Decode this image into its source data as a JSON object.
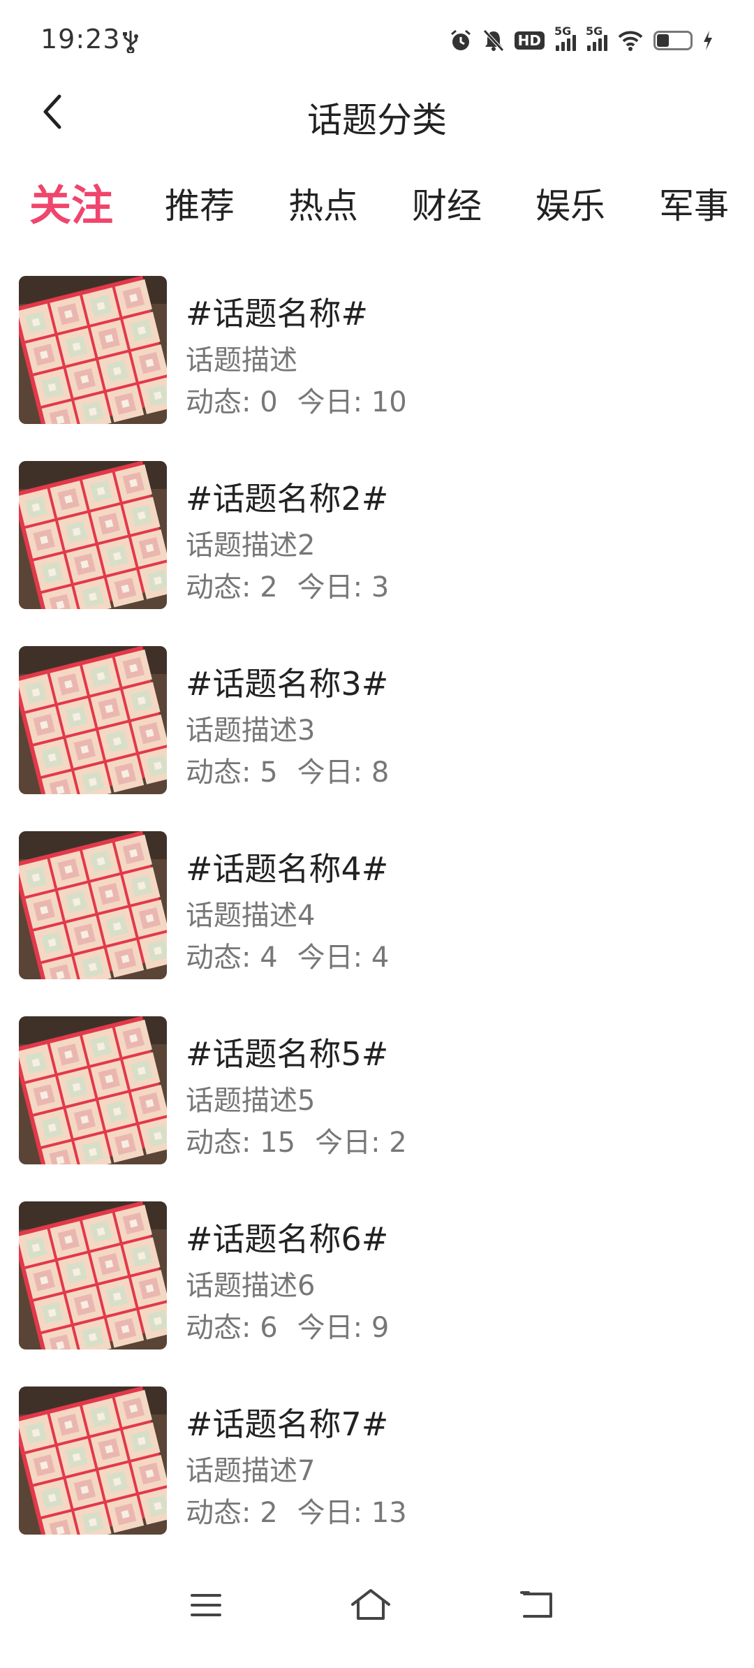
{
  "status_bar": {
    "time": "19:23",
    "hd_label": "HD",
    "signal_label_1": "5G",
    "signal_label_2": "5G",
    "icons": [
      "usb-icon",
      "alarm-icon",
      "mute-icon",
      "hd-icon",
      "signal-icon",
      "wifi-icon",
      "battery-icon",
      "charging-icon"
    ]
  },
  "header": {
    "title": "话题分类",
    "back_icon": "chevron-left-icon"
  },
  "tabs": [
    {
      "label": "关注",
      "active": true
    },
    {
      "label": "推荐",
      "active": false
    },
    {
      "label": "热点",
      "active": false
    },
    {
      "label": "财经",
      "active": false
    },
    {
      "label": "娱乐",
      "active": false
    },
    {
      "label": "军事",
      "active": false
    }
  ],
  "topics": [
    {
      "name": "#话题名称#",
      "desc": "话题描述",
      "dynamic": "动态: 0",
      "today": "今日: 10"
    },
    {
      "name": "#话题名称2#",
      "desc": "话题描述2",
      "dynamic": "动态: 2",
      "today": "今日: 3"
    },
    {
      "name": "#话题名称3#",
      "desc": "话题描述3",
      "dynamic": "动态: 5",
      "today": "今日: 8"
    },
    {
      "name": "#话题名称4#",
      "desc": "话题描述4",
      "dynamic": "动态: 4",
      "today": "今日: 4"
    },
    {
      "name": "#话题名称5#",
      "desc": "话题描述5",
      "dynamic": "动态: 15",
      "today": "今日: 2"
    },
    {
      "name": "#话题名称6#",
      "desc": "话题描述6",
      "dynamic": "动态: 6",
      "today": "今日: 9"
    },
    {
      "name": "#话题名称7#",
      "desc": "话题描述7",
      "dynamic": "动态: 2",
      "today": "今日: 13"
    }
  ],
  "nav_bar": {
    "icons": [
      "menu-icon",
      "home-icon",
      "back-icon"
    ]
  },
  "colors": {
    "accent": "#f0456c",
    "text_primary": "#222222",
    "text_secondary": "#777777"
  }
}
